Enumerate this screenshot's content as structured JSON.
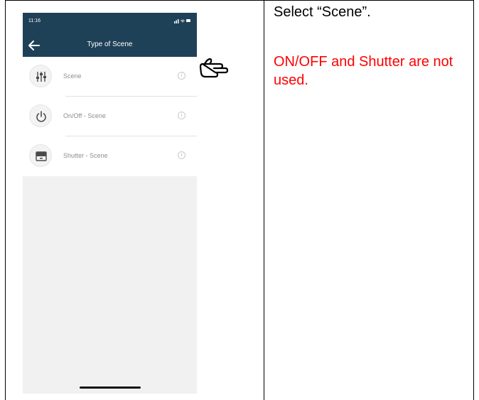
{
  "status_bar": {
    "time": "11:16",
    "indicators": "signal-wifi-battery"
  },
  "nav": {
    "title": "Type of Scene",
    "back_icon": "arrow-left-icon"
  },
  "scene_types": [
    {
      "label": "Scene",
      "icon": "sliders-icon"
    },
    {
      "label": "On/Off - Scene",
      "icon": "power-icon"
    },
    {
      "label": "Shutter - Scene",
      "icon": "shutter-icon"
    }
  ],
  "info_glyph": "i",
  "pointer_icon": "pointing-hand-icon",
  "instructions": {
    "select": "Select “Scene”.",
    "note": "ON/OFF and Shutter are not used."
  },
  "colors": {
    "header": "#1f4158",
    "note_text": "#ff0000",
    "list_background": "#f1f1f1"
  }
}
